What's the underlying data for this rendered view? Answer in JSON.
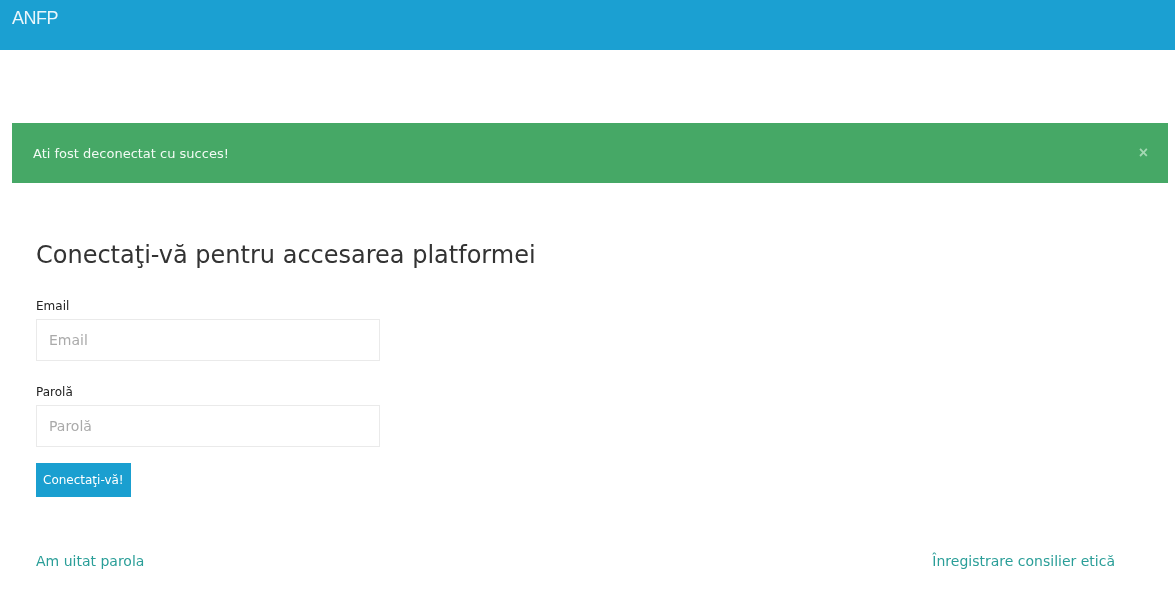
{
  "navbar": {
    "brand": "ANFP"
  },
  "alert": {
    "message": "Ati fost deconectat cu succes!",
    "close": "×"
  },
  "heading": "Conectaţi-vă pentru accesarea platformei",
  "fields": [
    {
      "label": "Email",
      "placeholder": "Email"
    },
    {
      "label": "Parolă",
      "placeholder": "Parolă"
    }
  ],
  "submit": "Conectaţi-vă!",
  "links": [
    "Am uitat parola",
    "Înregistrare consilier etică"
  ]
}
